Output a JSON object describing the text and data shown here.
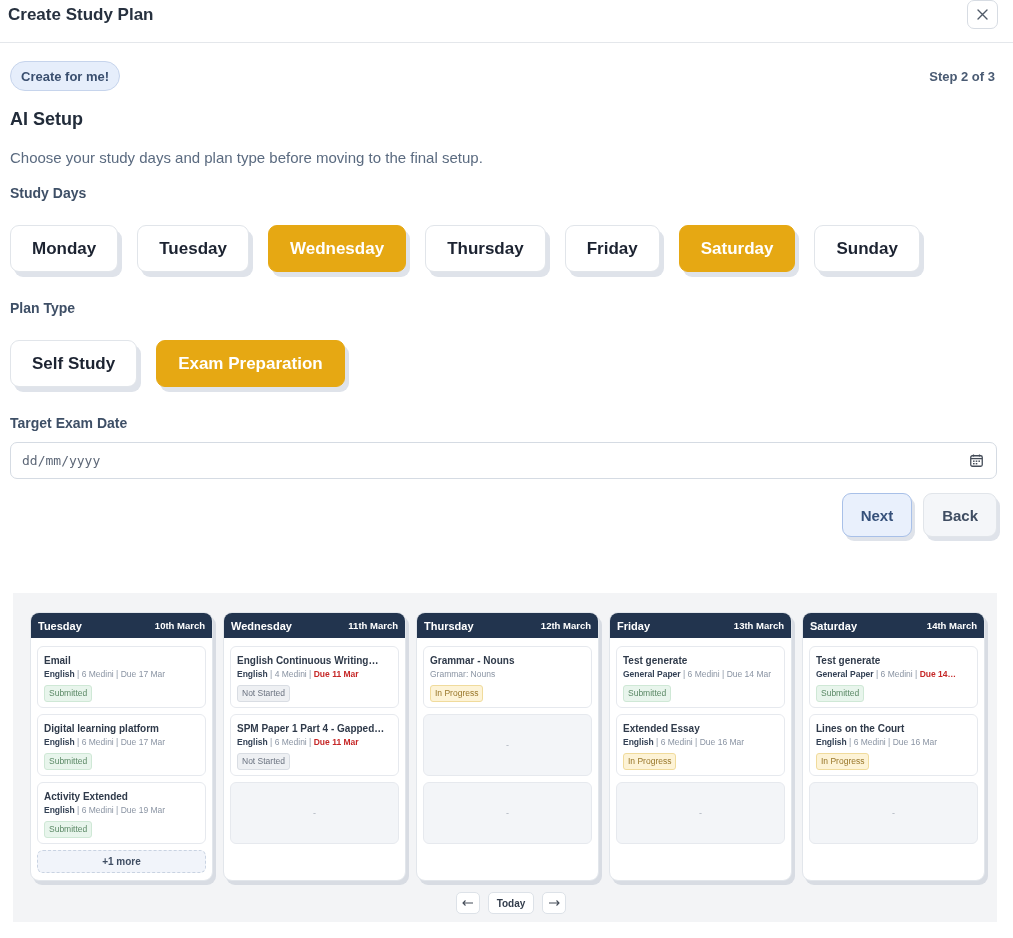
{
  "dialog": {
    "title": "Create Study Plan"
  },
  "step": {
    "badge": "Create for me!",
    "progress": "Step 2 of 3"
  },
  "intro": {
    "title": "AI Setup",
    "description": "Choose your study days and plan type before moving to the final setup."
  },
  "study_days": {
    "label": "Study Days",
    "options": [
      {
        "label": "Monday",
        "selected": false
      },
      {
        "label": "Tuesday",
        "selected": false
      },
      {
        "label": "Wednesday",
        "selected": true
      },
      {
        "label": "Thursday",
        "selected": false
      },
      {
        "label": "Friday",
        "selected": false
      },
      {
        "label": "Saturday",
        "selected": true
      },
      {
        "label": "Sunday",
        "selected": false
      }
    ]
  },
  "plan_type": {
    "label": "Plan Type",
    "options": [
      {
        "label": "Self Study",
        "selected": false
      },
      {
        "label": "Exam Preparation",
        "selected": true
      }
    ]
  },
  "exam_date": {
    "label": "Target Exam Date",
    "placeholder": "dd/mm/yyyy"
  },
  "actions": [
    {
      "label": "Next",
      "kind": "primary"
    },
    {
      "label": "Back",
      "kind": "secondary"
    }
  ],
  "week": {
    "columns": [
      {
        "day": "Tuesday",
        "date": "10th March",
        "slots": [
          {
            "kind": "task",
            "title": "Email",
            "meta": "**English** | 6 Medini |",
            "due": "Due 17 Mar",
            "overdue": false,
            "status": {
              "label": "Submitted",
              "kind": "success"
            }
          },
          {
            "kind": "task",
            "title": "Digital learning platform",
            "meta": "**English** | 6 Medini |",
            "due": "Due 17 Mar",
            "overdue": false,
            "status": {
              "label": "Submitted",
              "kind": "success"
            }
          },
          {
            "kind": "task",
            "title": "Activity Extended",
            "meta": "**English** | 6 Medini |",
            "due": "Due 19 Mar",
            "overdue": false,
            "status": {
              "label": "Submitted",
              "kind": "success"
            }
          }
        ],
        "more": "+1 more"
      },
      {
        "day": "Wednesday",
        "date": "11th March",
        "slots": [
          {
            "kind": "task",
            "title": "English Continuous Writing…",
            "meta": "**English** | 4 Medini |",
            "due": "Due 11 Mar",
            "overdue": true,
            "status": {
              "label": "Not Started",
              "kind": "neutral"
            }
          },
          {
            "kind": "task",
            "title": "SPM Paper 1 Part 4 - Gapped…",
            "meta": "**English** | 6 Medini |",
            "due": "Due 11 Mar",
            "overdue": true,
            "status": {
              "label": "Not Started",
              "kind": "neutral"
            }
          },
          {
            "kind": "empty",
            "text": "-"
          }
        ]
      },
      {
        "day": "Thursday",
        "date": "12th March",
        "slots": [
          {
            "kind": "task",
            "title": "Grammar - Nouns",
            "meta": "Grammar: Nouns",
            "status": {
              "label": "In Progress",
              "kind": "warning"
            }
          },
          {
            "kind": "empty",
            "text": "-"
          },
          {
            "kind": "empty",
            "text": "-"
          }
        ]
      },
      {
        "day": "Friday",
        "date": "13th March",
        "slots": [
          {
            "kind": "task",
            "title": "Test generate",
            "meta": "**General Paper** | 6 Medini |",
            "due": "Due 14 Mar",
            "overdue": false,
            "status": {
              "label": "Submitted",
              "kind": "success"
            }
          },
          {
            "kind": "task",
            "title": "Extended Essay",
            "meta": "**English** | 6 Medini |",
            "due": "Due 16 Mar",
            "overdue": false,
            "status": {
              "label": "In Progress",
              "kind": "warning"
            }
          },
          {
            "kind": "empty",
            "text": "-"
          }
        ]
      },
      {
        "day": "Saturday",
        "date": "14th March",
        "slots": [
          {
            "kind": "task",
            "title": "Test generate",
            "meta": "**General Paper** | 6 Medini |",
            "due": "Due 14…",
            "overdue": true,
            "status": {
              "label": "Submitted",
              "kind": "success"
            }
          },
          {
            "kind": "task",
            "title": "Lines on the Court",
            "meta": "**English** | 6 Medini |",
            "due": "Due 16 Mar",
            "overdue": false,
            "status": {
              "label": "In Progress",
              "kind": "warning"
            }
          },
          {
            "kind": "empty",
            "text": "-"
          }
        ]
      }
    ],
    "today": "Today"
  }
}
